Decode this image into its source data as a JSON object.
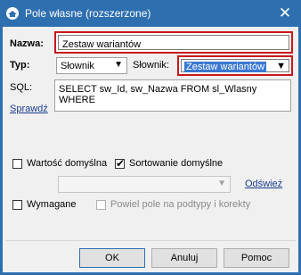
{
  "window": {
    "title": "Pole własne (rozszerzone)",
    "close_glyph": "✕",
    "accent_color": "#2e6fb0"
  },
  "form": {
    "nazwa_label": "Nazwa:",
    "nazwa_value": "Zestaw wariantów",
    "typ_label": "Typ:",
    "typ_value": "Słownik",
    "slownik_label": "Słownik:",
    "slownik_value": "Zestaw wariantów",
    "sql_label": "SQL:",
    "sql_value": "SELECT sw_Id, sw_Nazwa FROM sl_Wlasny WHERE",
    "sprawdz_link": "Sprawdź",
    "wartosc_domyslna_label": "Wartość domyślna",
    "wartosc_domyslna_checked": false,
    "sortowanie_domyslne_label": "Sortowanie domyślne",
    "sortowanie_domyslne_checked": true,
    "odswiez_link": "Odśwież",
    "wymagane_label": "Wymagane",
    "wymagane_checked": false,
    "powiel_label": "Powiel pole na podtypy i korekty",
    "powiel_checked": false
  },
  "buttons": {
    "ok": "OK",
    "anuluj": "Anuluj",
    "pomoc": "Pomoc"
  },
  "icons": {
    "app": "app-icon",
    "close": "close-icon",
    "dropdown": "chevron-down-icon",
    "check": "checkmark-icon"
  },
  "colors": {
    "required_border": "#c8171d",
    "selection": "#3a78d0"
  }
}
